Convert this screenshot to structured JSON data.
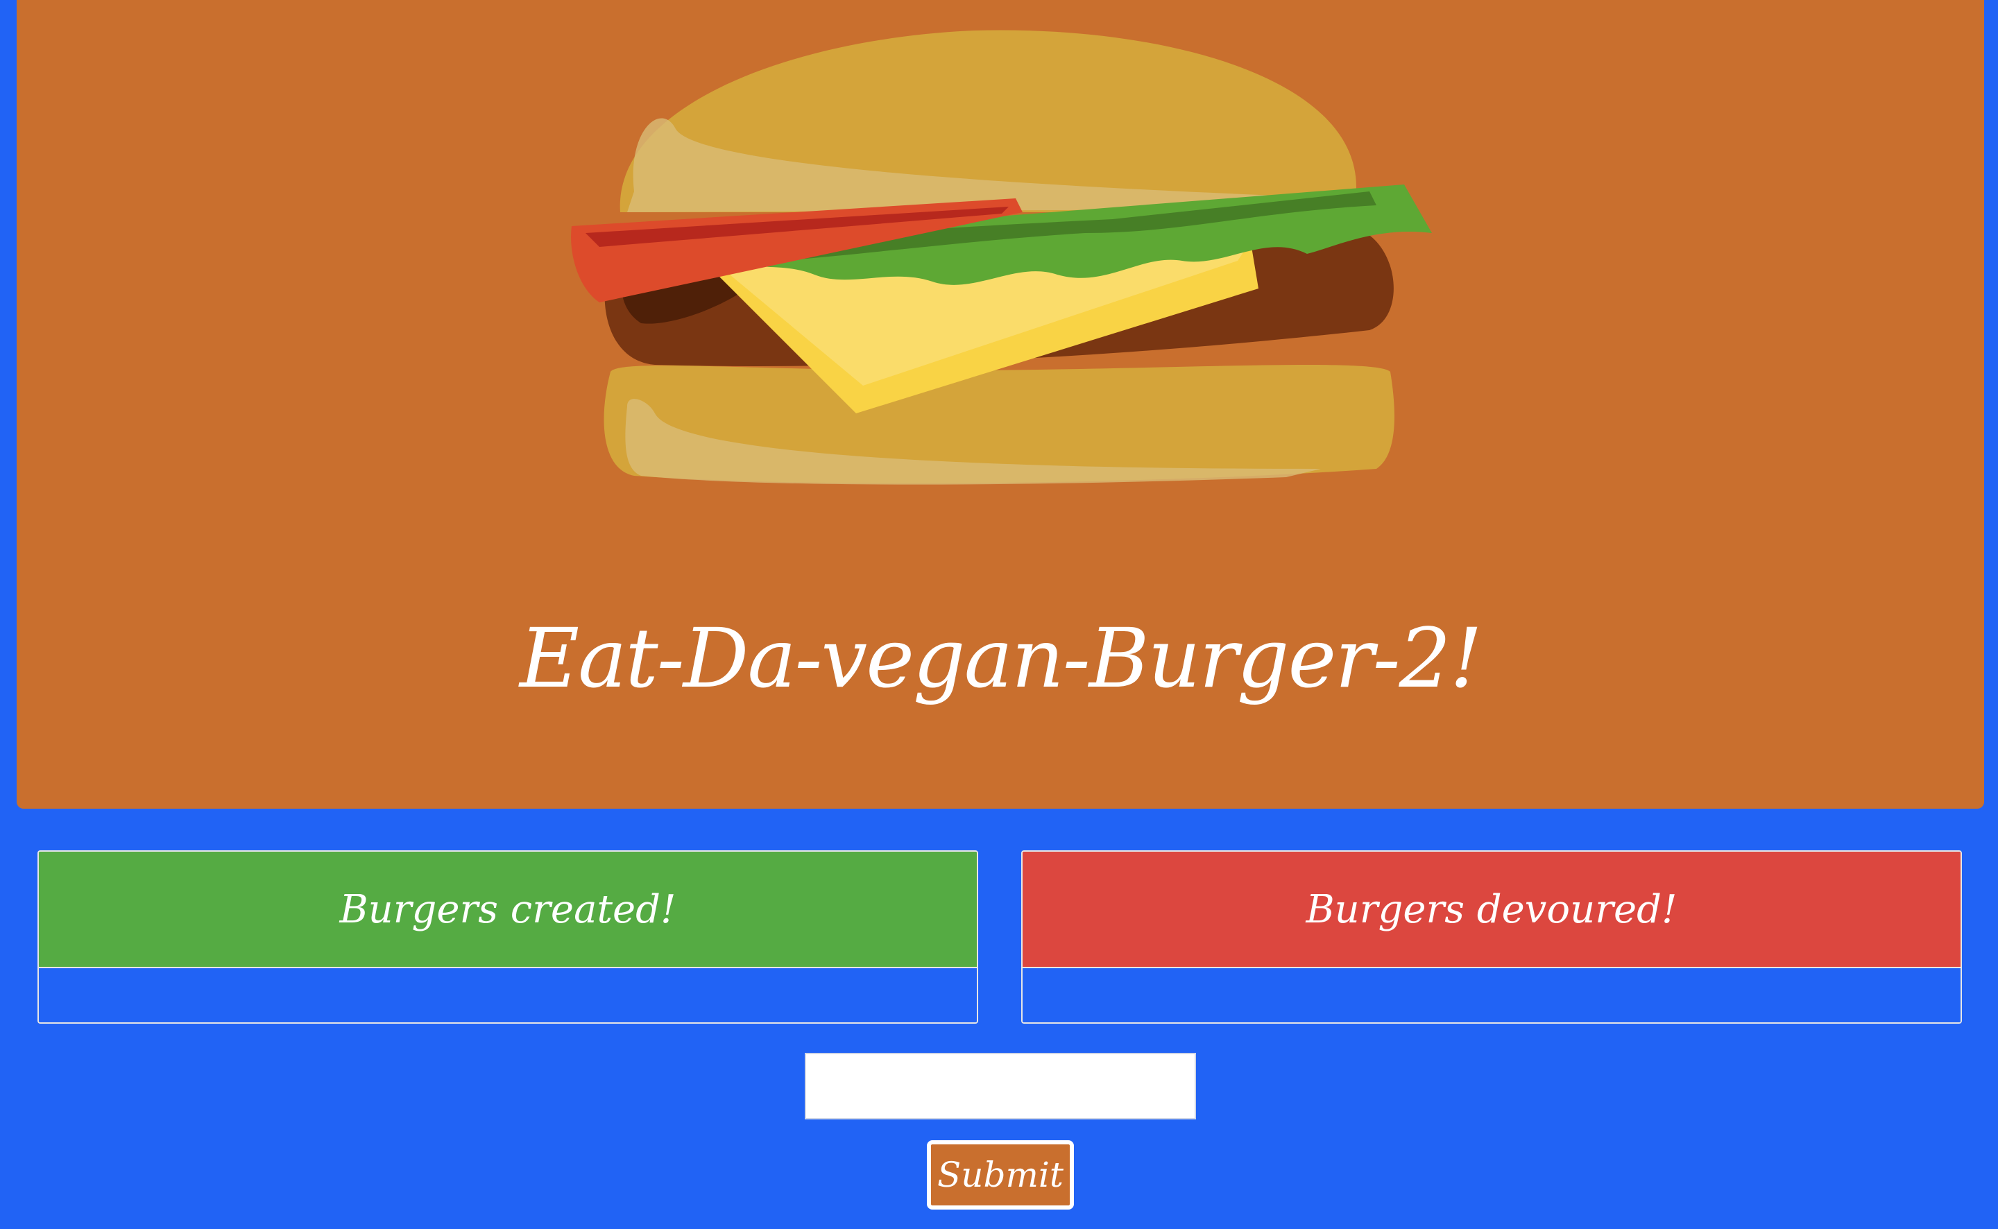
{
  "header": {
    "title": "Eat-Da-vegan-Burger-2!",
    "image_icon": "burger-illustration"
  },
  "panels": {
    "created": {
      "heading": "Burgers created!",
      "items": []
    },
    "devoured": {
      "heading": "Burgers devoured!",
      "items": []
    }
  },
  "form": {
    "burger_input_value": "",
    "submit_label": "Submit"
  },
  "colors": {
    "page_background": "#2163f5",
    "jumbotron": "#c96f2e",
    "created_heading": "#55ab43",
    "devoured_heading": "#dc473f",
    "text": "#ffffff"
  }
}
